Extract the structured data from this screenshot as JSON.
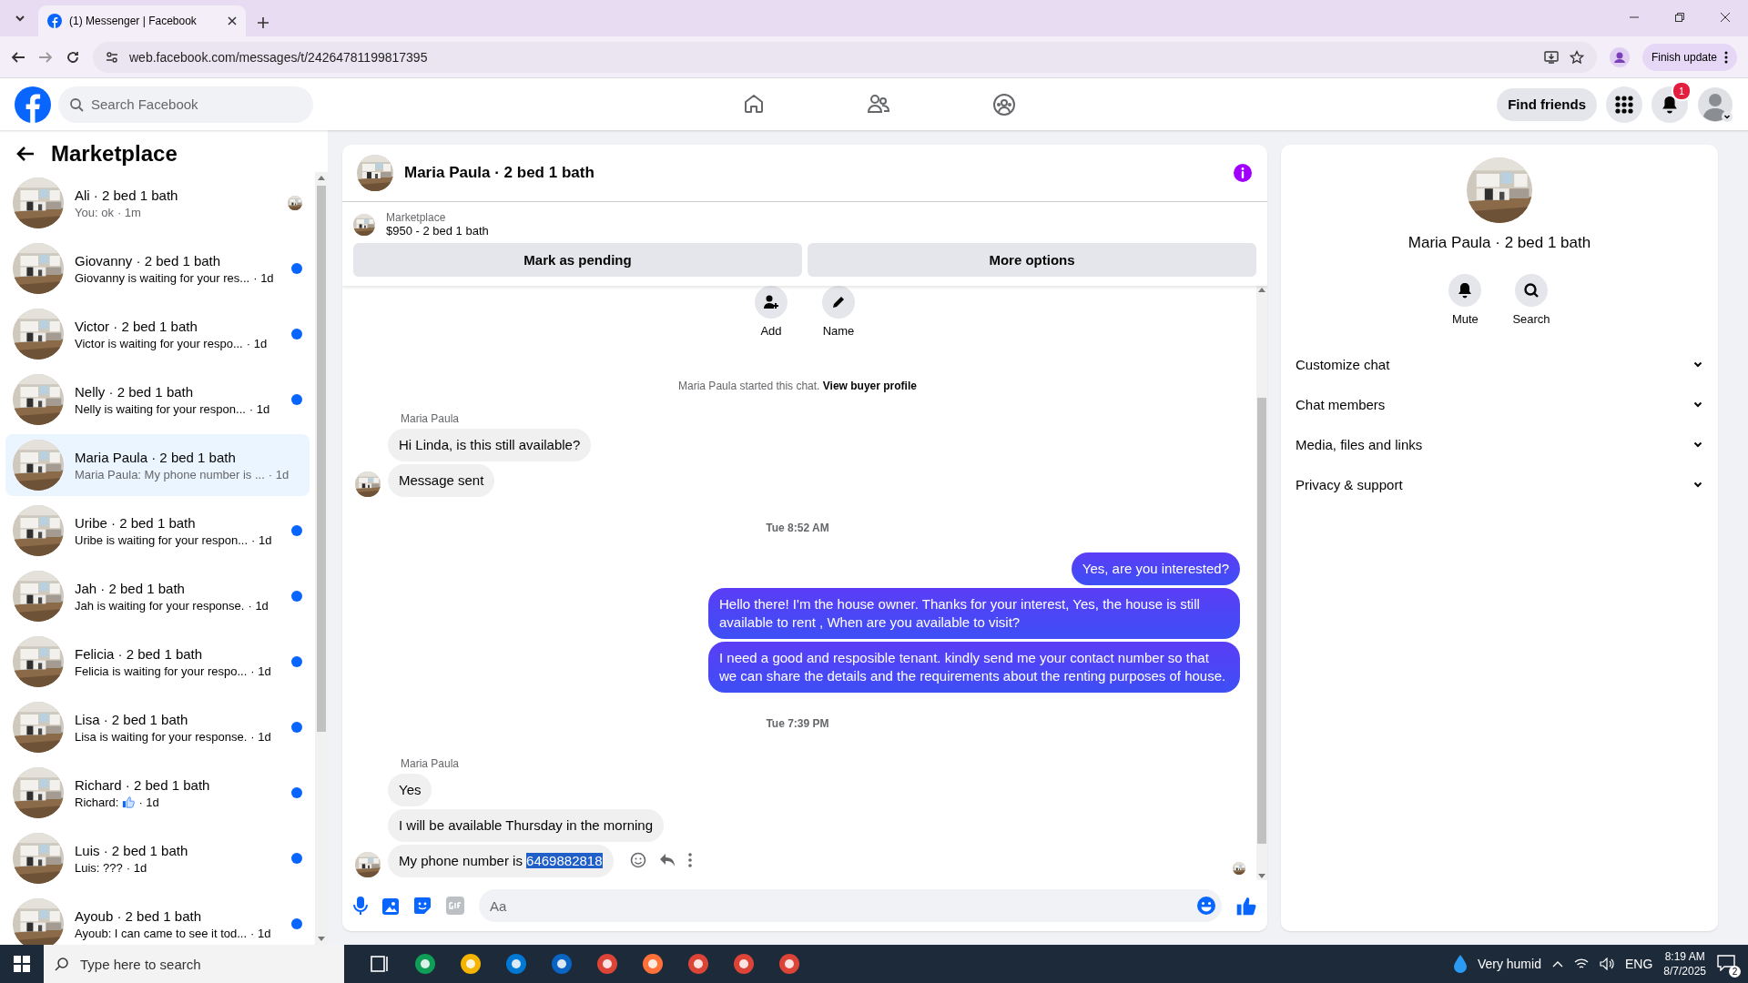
{
  "browser": {
    "tab_title": "(1) Messenger | Facebook",
    "url": "web.facebook.com/messages/t/24264781199817395",
    "update_button": "Finish update"
  },
  "topbar": {
    "search_placeholder": "Search Facebook",
    "nav": [
      {
        "kind": "home"
      },
      {
        "kind": "friends"
      },
      {
        "kind": "groups"
      }
    ],
    "find_friends": "Find friends",
    "notification_count": "1"
  },
  "sidebar": {
    "title": "Marketplace",
    "conversations": [
      {
        "name": "Ali · 2 bed 1 bath",
        "preview": "You: ok",
        "time": "· 1m",
        "unread": false,
        "seen": true,
        "selected": false,
        "thumbs_up": false
      },
      {
        "name": "Giovanny · 2 bed 1 bath",
        "preview": "Giovanny is waiting for your res...",
        "time": "· 1d",
        "unread": true,
        "seen": false,
        "selected": false,
        "thumbs_up": false
      },
      {
        "name": "Victor · 2 bed 1 bath",
        "preview": "Victor is waiting for your respo...",
        "time": "· 1d",
        "unread": true,
        "seen": false,
        "selected": false,
        "thumbs_up": false
      },
      {
        "name": "Nelly · 2 bed 1 bath",
        "preview": "Nelly is waiting for your respon...",
        "time": "· 1d",
        "unread": true,
        "seen": false,
        "selected": false,
        "thumbs_up": false
      },
      {
        "name": "Maria Paula · 2 bed 1 bath",
        "preview": "Maria Paula: My phone number is ...",
        "time": "· 1d",
        "unread": false,
        "seen": false,
        "selected": true,
        "thumbs_up": false
      },
      {
        "name": "Uribe · 2 bed 1 bath",
        "preview": "Uribe is waiting for your respon...",
        "time": "· 1d",
        "unread": true,
        "seen": false,
        "selected": false,
        "thumbs_up": false
      },
      {
        "name": "Jah · 2 bed 1 bath",
        "preview": "Jah is waiting for your response.",
        "time": "· 1d",
        "unread": true,
        "seen": false,
        "selected": false,
        "thumbs_up": false
      },
      {
        "name": "Felicia · 2 bed 1 bath",
        "preview": "Felicia is waiting for your respo...",
        "time": "· 1d",
        "unread": true,
        "seen": false,
        "selected": false,
        "thumbs_up": false
      },
      {
        "name": "Lisa · 2 bed 1 bath",
        "preview": "Lisa is waiting for your response.",
        "time": "· 1d",
        "unread": true,
        "seen": false,
        "selected": false,
        "thumbs_up": false
      },
      {
        "name": "Richard · 2 bed 1 bath",
        "preview": "Richard:",
        "time": "· 1d",
        "unread": true,
        "seen": false,
        "selected": false,
        "thumbs_up": true
      },
      {
        "name": "Luis · 2 bed 1 bath",
        "preview": "Luis: ???",
        "time": "· 1d",
        "unread": true,
        "seen": false,
        "selected": false,
        "thumbs_up": false
      },
      {
        "name": "Ayoub · 2 bed 1 bath",
        "preview": "Ayoub: I can came to see it tod...",
        "time": "· 1d",
        "unread": true,
        "seen": false,
        "selected": false,
        "thumbs_up": false
      }
    ]
  },
  "chat": {
    "title": "Maria Paula · 2 bed 1 bath",
    "listing": {
      "label": "Marketplace",
      "detail": "$950 - 2 bed 1 bath"
    },
    "buttons": [
      "Mark as pending",
      "More options"
    ],
    "actions": [
      {
        "kind": "add",
        "label": "Add"
      },
      {
        "kind": "name",
        "label": "Name"
      }
    ],
    "notice": {
      "text": "Maria Paula started this chat.",
      "link": "View buyer profile"
    },
    "messages": [
      {
        "kind": "sender",
        "text": "Maria Paula"
      },
      {
        "kind": "incoming",
        "text": "Hi Linda, is this still available?",
        "avatar": false,
        "hovered": false
      },
      {
        "kind": "incoming",
        "text": "Message sent",
        "avatar": true,
        "hovered": false
      },
      {
        "kind": "time",
        "text": "Tue 8:52 AM"
      },
      {
        "kind": "outgoing",
        "text": "Yes, are you interested?"
      },
      {
        "kind": "outgoing",
        "text": "Hello there! I'm the house owner. Thanks for your interest, Yes, the house is still available to rent , When are you available to visit?"
      },
      {
        "kind": "outgoing",
        "text": "I need a good and resposible tenant.  kindly send me your contact number so that we can share the details and the requirements about the renting purposes of house."
      },
      {
        "kind": "time",
        "text": "Tue 7:39 PM"
      },
      {
        "kind": "sender",
        "text": "Maria Paula"
      },
      {
        "kind": "incoming",
        "text": "Yes",
        "avatar": false,
        "hovered": false
      },
      {
        "kind": "incoming",
        "text": "I will be available Thursday in the morning",
        "avatar": false,
        "hovered": false
      },
      {
        "kind": "incoming",
        "text": "My phone number is",
        "selected_text": "6469882818",
        "avatar": true,
        "hovered": true
      }
    ],
    "seen_by_avatar": true,
    "composer": {
      "placeholder": "Aa"
    }
  },
  "details": {
    "name": "Maria Paula · 2 bed 1 bath",
    "actions": [
      {
        "kind": "mute",
        "label": "Mute"
      },
      {
        "kind": "search",
        "label": "Search"
      }
    ],
    "sections": [
      {
        "label": "Customize chat",
        "expanded": false
      },
      {
        "label": "Chat members",
        "expanded": false
      },
      {
        "label": "Media, files and links",
        "expanded": false
      },
      {
        "label": "Privacy & support",
        "expanded": false
      }
    ]
  },
  "taskbar": {
    "search_placeholder": "Type here to search",
    "weather": "Very humid",
    "language": "ENG",
    "time": "8:19 AM",
    "date": "8/7/2025",
    "notification_count": "2"
  }
}
